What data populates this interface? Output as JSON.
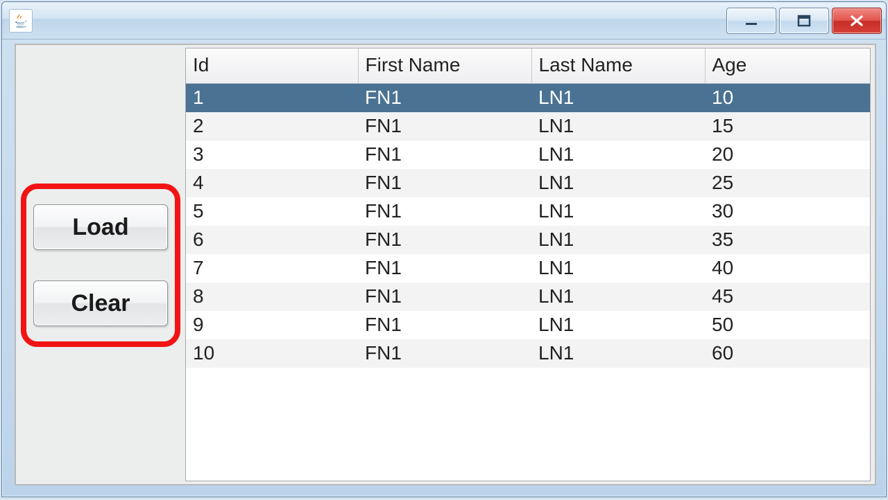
{
  "window": {
    "title": ""
  },
  "buttons": {
    "load": "Load",
    "clear": "Clear"
  },
  "table": {
    "columns": [
      "Id",
      "First Name",
      "Last Name",
      "Age"
    ],
    "rows": [
      {
        "id": "1",
        "first": "FN1",
        "last": "LN1",
        "age": "10",
        "selected": true
      },
      {
        "id": "2",
        "first": "FN1",
        "last": "LN1",
        "age": "15",
        "selected": false
      },
      {
        "id": "3",
        "first": "FN1",
        "last": "LN1",
        "age": "20",
        "selected": false
      },
      {
        "id": "4",
        "first": "FN1",
        "last": "LN1",
        "age": "25",
        "selected": false
      },
      {
        "id": "5",
        "first": "FN1",
        "last": "LN1",
        "age": "30",
        "selected": false
      },
      {
        "id": "6",
        "first": "FN1",
        "last": "LN1",
        "age": "35",
        "selected": false
      },
      {
        "id": "7",
        "first": "FN1",
        "last": "LN1",
        "age": "40",
        "selected": false
      },
      {
        "id": "8",
        "first": "FN1",
        "last": "LN1",
        "age": "45",
        "selected": false
      },
      {
        "id": "9",
        "first": "FN1",
        "last": "LN1",
        "age": "50",
        "selected": false
      },
      {
        "id": "10",
        "first": "FN1",
        "last": "LN1",
        "age": "60",
        "selected": false
      }
    ]
  }
}
